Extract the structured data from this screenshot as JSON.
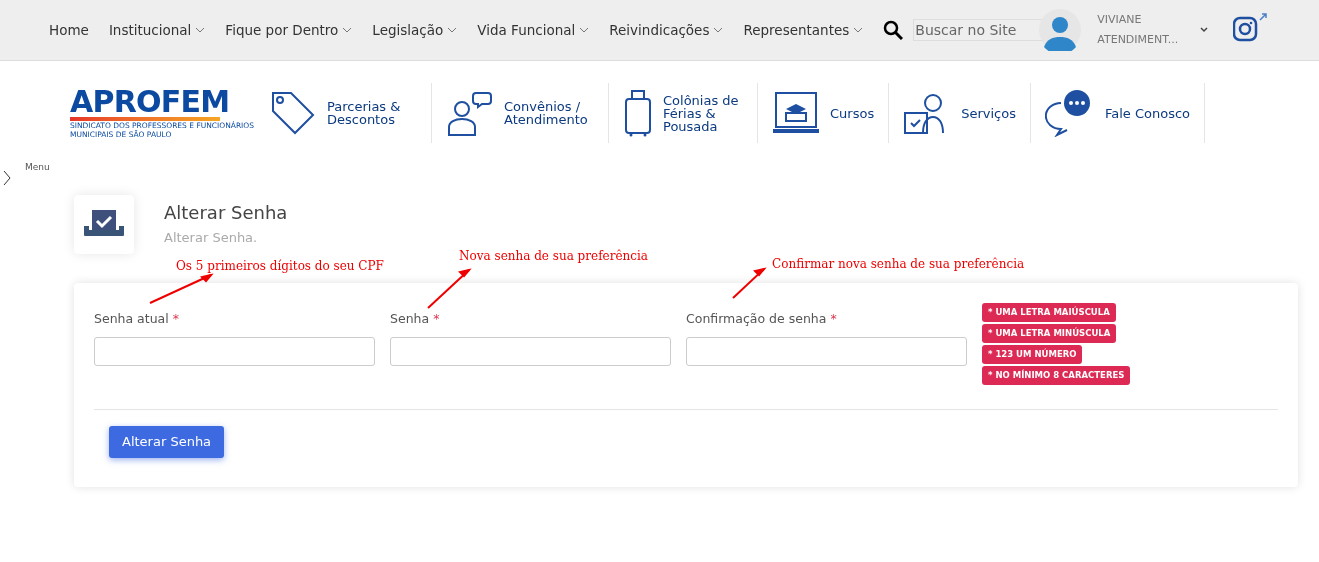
{
  "nav": [
    {
      "label": "Home",
      "dropdown": false
    },
    {
      "label": "Institucional",
      "dropdown": true
    },
    {
      "label": "Fique por Dentro",
      "dropdown": true
    },
    {
      "label": "Legislação",
      "dropdown": true
    },
    {
      "label": "Vida Funcional",
      "dropdown": true
    },
    {
      "label": "Reivindicações",
      "dropdown": true
    },
    {
      "label": "Representantes",
      "dropdown": true
    }
  ],
  "search": {
    "placeholder": "Buscar no Site"
  },
  "user": {
    "name": "VIVIANE",
    "role": "ATENDIMENT..."
  },
  "logo": {
    "name": "APROFEM",
    "tagline": [
      "SINDICATO DOS PROFESSORES E FUNCIONÁRIOS",
      "MUNICIPAIS DE SÃO PAULO"
    ]
  },
  "services": [
    {
      "kind": "tag",
      "label": "Parcerias & Descontos"
    },
    {
      "kind": "doctor",
      "label": "Convênios / Atendimento"
    },
    {
      "kind": "suitcase",
      "label": "Colônias de Férias & Pousada"
    },
    {
      "kind": "laptop",
      "label": "Cursos"
    },
    {
      "kind": "support",
      "label": "Serviços"
    },
    {
      "kind": "chat",
      "label": "Fale Conosco"
    }
  ],
  "menu_label": "Menu",
  "page": {
    "title": "Alterar Senha",
    "subtitle": "Alterar Senha."
  },
  "annotations": [
    "Os 5 primeiros dígitos do seu CPF",
    "Nova senha de sua preferência",
    "Confirmar nova senha de sua preferência"
  ],
  "fields": [
    {
      "label": "Senha atual",
      "required_mark": "*"
    },
    {
      "label": "Senha",
      "required_mark": "*"
    },
    {
      "label": "Confirmação de senha",
      "required_mark": "*"
    }
  ],
  "rules": [
    "* UMA LETRA MAIÚSCULA",
    "* UMA LETRA MINÚSCULA",
    "* 123 UM NÚMERO",
    "* NO MÍNIMO 8 CARACTERES"
  ],
  "button": "Alterar Senha"
}
